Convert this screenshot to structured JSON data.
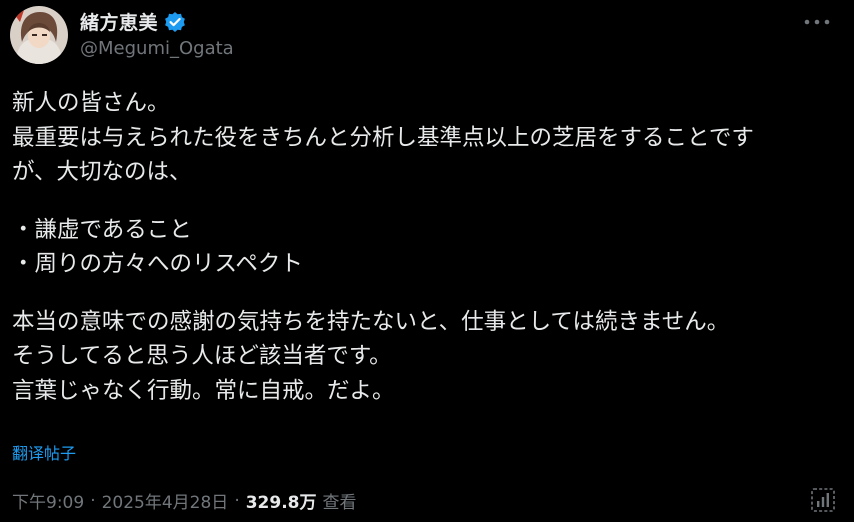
{
  "author": {
    "display_name": "緒方恵美",
    "handle": "@Megumi_Ogata",
    "verified": true
  },
  "post": {
    "lines": [
      "新人の皆さん。",
      "最重要は与えられた役をきちんと分析し基準点以上の芝居をすることです",
      "が、大切なのは、",
      "",
      "・謙虚であること",
      "・周りの方々へのリスペクト",
      "",
      "本当の意味での感謝の気持ちを持たないと、仕事としては続きません。",
      "そうしてると思う人ほど該当者です。",
      "言葉じゃなく行動。常に自戒。だよ。"
    ],
    "translate_label": "翻译帖子"
  },
  "meta": {
    "time": "下午9:09",
    "date": "2025年4月28日",
    "views_count": "329.8万",
    "views_label": "查看"
  },
  "colors": {
    "background": "#000000",
    "text": "#e7e9ea",
    "secondary": "#71767b",
    "accent": "#1d9bf0"
  },
  "icons": {
    "verified": "verified-badge-icon",
    "more": "more-options-icon",
    "analytics": "view-analytics-icon"
  }
}
